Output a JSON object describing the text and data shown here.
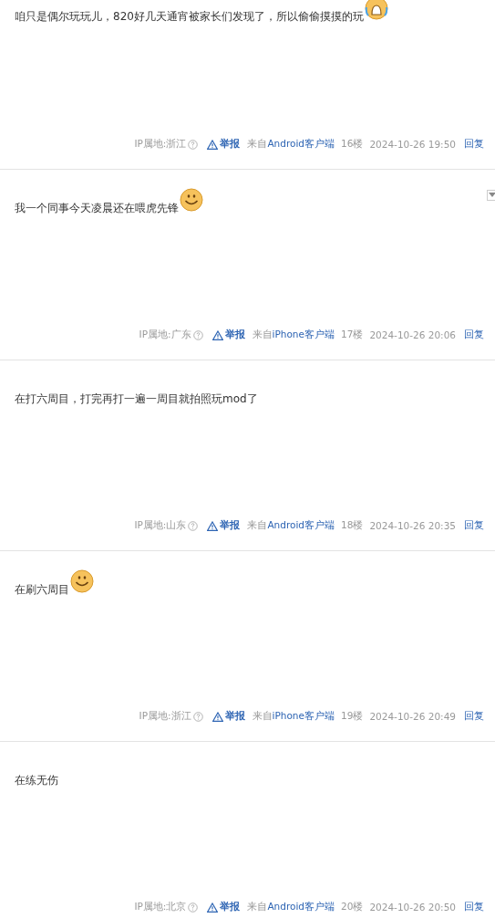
{
  "posts": [
    {
      "content": "咱只是偶尔玩玩儿，820好几天通宵被家长们发现了，所以偷偷摸摸的玩",
      "emoji": {
        "kind": "crying"
      },
      "menu_toggle": false,
      "ip": "IP属地:浙江",
      "report": "举报",
      "source_prefix": "来自",
      "source": "Android客户端",
      "floor": "16楼",
      "time": "2024-10-26 19:50",
      "reply": "回复"
    },
    {
      "content": "我一个同事今天凌晨还在喂虎先锋",
      "emoji": {
        "kind": "smile"
      },
      "menu_toggle": true,
      "ip": "IP属地:广东",
      "report": "举报",
      "source_prefix": "来自",
      "source": "iPhone客户端",
      "floor": "17楼",
      "time": "2024-10-26 20:06",
      "reply": "回复"
    },
    {
      "content": "在打六周目，打完再打一遍一周目就拍照玩mod了",
      "menu_toggle": false,
      "ip": "IP属地:山东",
      "report": "举报",
      "source_prefix": "来自",
      "source": "Android客户端",
      "floor": "18楼",
      "time": "2024-10-26 20:35",
      "reply": "回复"
    },
    {
      "content": "在刷六周目",
      "emoji": {
        "kind": "smile"
      },
      "menu_toggle": false,
      "ip": "IP属地:浙江",
      "report": "举报",
      "source_prefix": "来自",
      "source": "iPhone客户端",
      "floor": "19楼",
      "time": "2024-10-26 20:49",
      "reply": "回复"
    },
    {
      "content": "在练无伤",
      "menu_toggle": false,
      "ip": "IP属地:北京",
      "report": "举报",
      "source_prefix": "来自",
      "source": "Android客户端",
      "floor": "20楼",
      "time": "2024-10-26 20:50",
      "reply": "回复"
    }
  ]
}
